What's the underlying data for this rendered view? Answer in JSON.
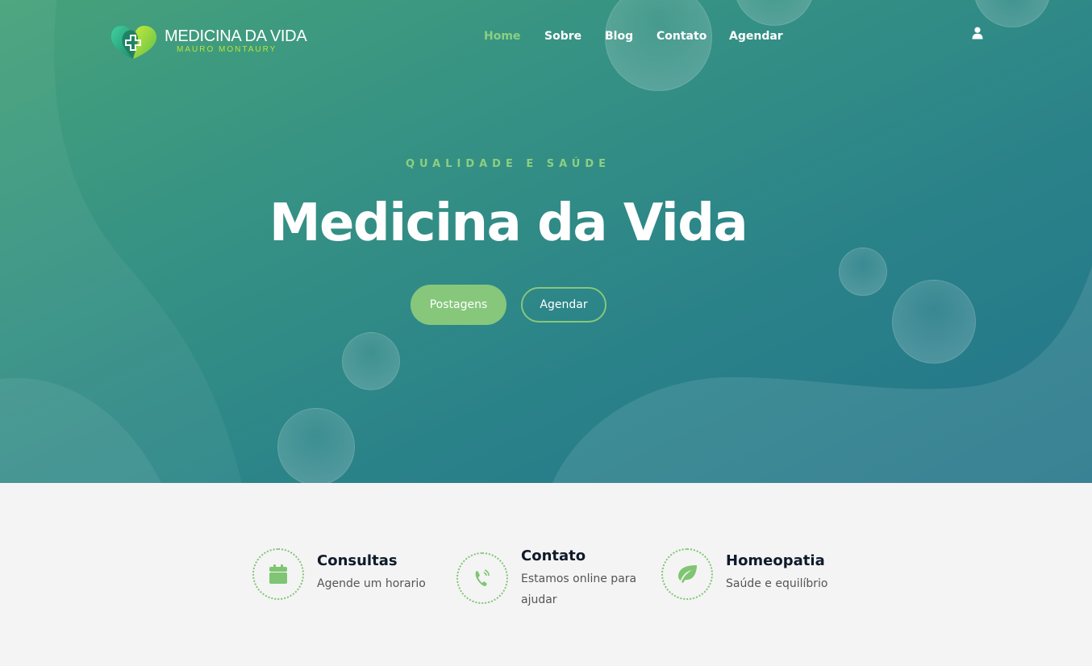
{
  "brand": {
    "name": "MEDICINA DA VIDA",
    "subtitle": "MAURO MONTAURY",
    "accent": "#8ccf80",
    "logo_lime": "#b9e43a"
  },
  "nav": {
    "items": [
      {
        "label": "Home",
        "active": true
      },
      {
        "label": "Sobre",
        "active": false
      },
      {
        "label": "Blog",
        "active": false
      },
      {
        "label": "Contato",
        "active": false
      },
      {
        "label": "Agendar",
        "active": false
      }
    ],
    "user_icon": "user-icon"
  },
  "hero": {
    "eyebrow": "QUALIDADE E SAÚDE",
    "title": "Medicina da Vida",
    "primary_button": "Postagens",
    "secondary_button": "Agendar"
  },
  "features": [
    {
      "icon": "calendar-icon",
      "title": "Consultas",
      "description": "Agende um horario"
    },
    {
      "icon": "phone-icon",
      "title": "Contato",
      "description": "Estamos online para ajudar"
    },
    {
      "icon": "leaf-icon",
      "title": "Homeopatia",
      "description": "Saúde e equilíbrio"
    }
  ]
}
